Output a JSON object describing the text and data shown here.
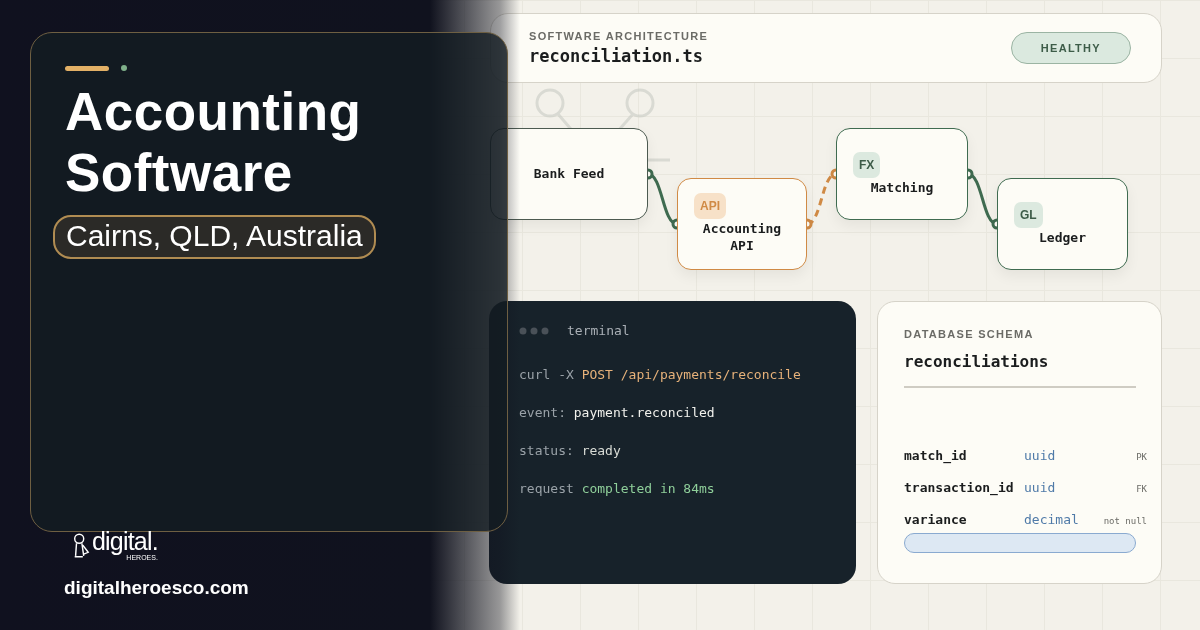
{
  "hero": {
    "title": "Accounting Software",
    "location": "Cairns, QLD, Australia",
    "brand": {
      "name": "digital.",
      "sub": "HEROES."
    },
    "website": "digitalheroesco.com"
  },
  "architecture": {
    "label": "SOFTWARE ARCHITECTURE",
    "file": "reconciliation.ts",
    "status": "HEALTHY"
  },
  "nodes": [
    {
      "kind": "source",
      "label": "Bank Feed"
    },
    {
      "kind": "api",
      "badge": "API",
      "label": "Accounting API"
    },
    {
      "kind": "step",
      "badge": "FX",
      "label": "Matching"
    },
    {
      "kind": "step",
      "badge": "GL",
      "label": "Ledger"
    }
  ],
  "terminal": {
    "title": "terminal",
    "lines": [
      {
        "kind": "request",
        "key": "curl -X",
        "value": "POST /api/payments/reconcile"
      },
      {
        "kind": "event",
        "key": "event:",
        "value": "payment.reconciled"
      },
      {
        "kind": "status",
        "key": "status:",
        "value": "ready"
      },
      {
        "kind": "success",
        "key": "request",
        "value": "completed in 84ms"
      }
    ]
  },
  "schema": {
    "label": "DATABASE SCHEMA",
    "table": "reconciliations",
    "fields": [
      {
        "name": "match_id",
        "type": "uuid",
        "constraint": "PK"
      },
      {
        "name": "transaction_id",
        "type": "uuid",
        "constraint": "FK"
      },
      {
        "name": "variance",
        "type": "decimal",
        "constraint": "not null"
      }
    ]
  }
}
